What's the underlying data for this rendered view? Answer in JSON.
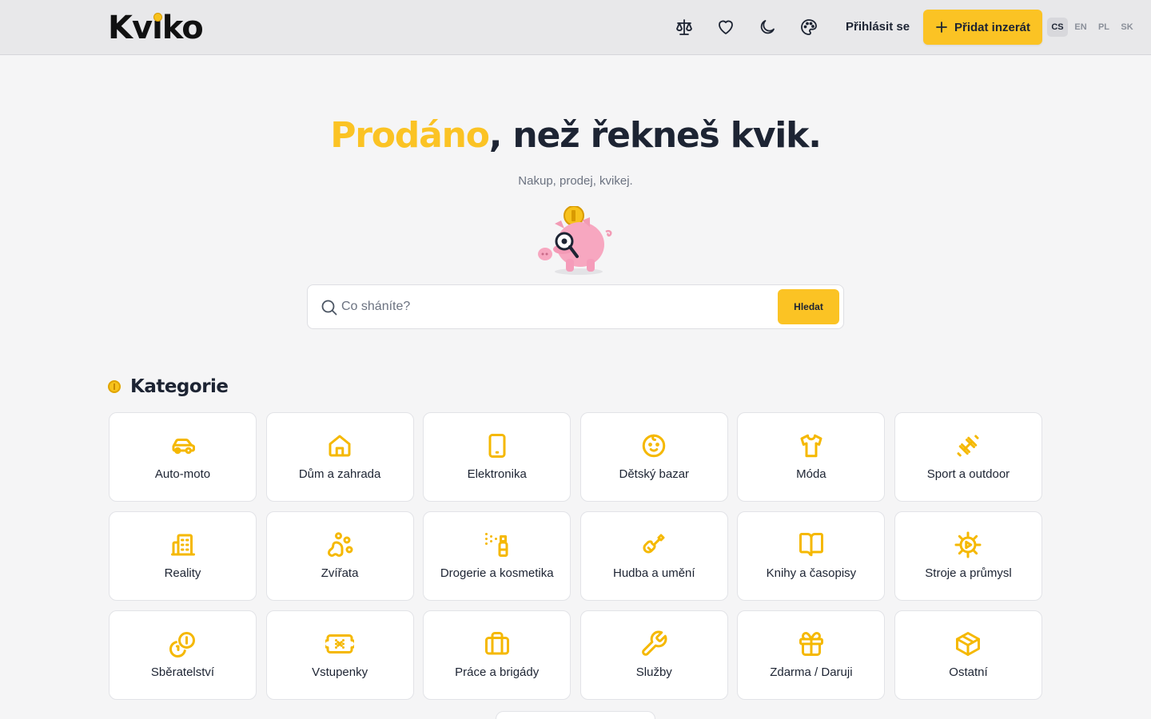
{
  "header": {
    "logo": "Kviko",
    "icons": [
      "scale-icon",
      "heart-icon",
      "moon-icon",
      "palette-icon"
    ],
    "login_label": "Přihlásit se",
    "add_label": "Přidat inzerát",
    "languages": [
      "CS",
      "EN",
      "PL",
      "SK"
    ],
    "active_language": "CS"
  },
  "hero": {
    "title_accent": "Prodáno",
    "title_rest": ", než řekneš kvik.",
    "subtitle": "Nakup, prodej, kvikej."
  },
  "search": {
    "placeholder": "Co sháníte?",
    "button_label": "Hledat"
  },
  "categories": {
    "title": "Kategorie",
    "items": [
      {
        "label": "Auto-moto",
        "icon": "car-icon"
      },
      {
        "label": "Dům a zahrada",
        "icon": "house-icon"
      },
      {
        "label": "Elektronika",
        "icon": "tablet-icon"
      },
      {
        "label": "Dětský bazar",
        "icon": "baby-icon"
      },
      {
        "label": "Móda",
        "icon": "shirt-icon"
      },
      {
        "label": "Sport a outdoor",
        "icon": "dumbbell-icon"
      },
      {
        "label": "Reality",
        "icon": "building-icon"
      },
      {
        "label": "Zvířata",
        "icon": "paw-icon"
      },
      {
        "label": "Drogerie a kosmetika",
        "icon": "spray-bottle-icon"
      },
      {
        "label": "Hudba a umění",
        "icon": "guitar-icon"
      },
      {
        "label": "Knihy a časopisy",
        "icon": "book-icon"
      },
      {
        "label": "Stroje a průmysl",
        "icon": "cog-icon"
      },
      {
        "label": "Sběratelství",
        "icon": "coins-icon"
      },
      {
        "label": "Vstupenky",
        "icon": "ticket-icon"
      },
      {
        "label": "Práce a brigády",
        "icon": "briefcase-icon"
      },
      {
        "label": "Služby",
        "icon": "wrench-icon"
      },
      {
        "label": "Zdarma / Daruji",
        "icon": "gift-icon"
      },
      {
        "label": "Ostatní",
        "icon": "box-icon"
      }
    ]
  },
  "colors": {
    "accent": "#fbc324",
    "text": "#1d2433",
    "background": "#f5f5f6",
    "header": "#e8e8ea"
  }
}
